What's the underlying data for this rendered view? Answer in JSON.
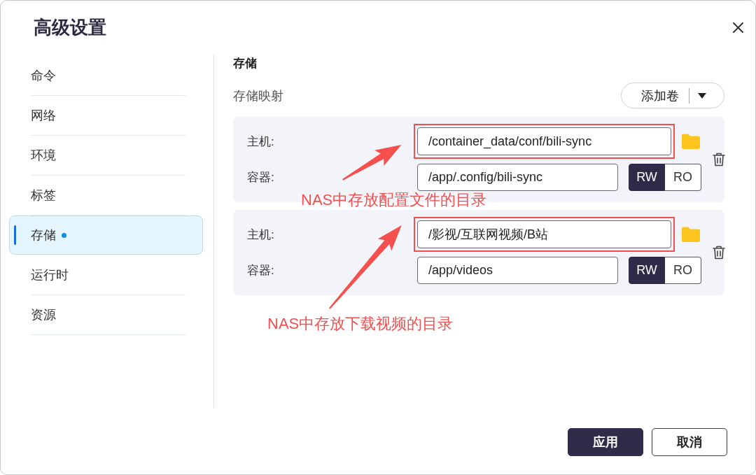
{
  "window": {
    "title": "高级设置"
  },
  "sidebar": {
    "items": [
      {
        "label": "命令",
        "selected": false,
        "modified": false
      },
      {
        "label": "网络",
        "selected": false,
        "modified": false
      },
      {
        "label": "环境",
        "selected": false,
        "modified": false
      },
      {
        "label": "标签",
        "selected": false,
        "modified": false
      },
      {
        "label": "存储",
        "selected": true,
        "modified": true
      },
      {
        "label": "运行时",
        "selected": false,
        "modified": false
      },
      {
        "label": "资源",
        "selected": false,
        "modified": false
      }
    ]
  },
  "storage": {
    "heading": "存储",
    "mapping_label": "存储映射",
    "add_button": "添加卷",
    "mounts": [
      {
        "host_label": "主机:",
        "host_path": "/container_data/conf/bili-sync",
        "host_highlighted": true,
        "container_label": "容器:",
        "container_path": "/app/.config/bili-sync",
        "modes": [
          {
            "label": "RW",
            "selected": true
          },
          {
            "label": "RO",
            "selected": false
          }
        ],
        "annotation": "NAS中存放配置文件的目录"
      },
      {
        "host_label": "主机:",
        "host_path": "/影视/互联网视频/B站",
        "host_highlighted": true,
        "container_label": "容器:",
        "container_path": "/app/videos",
        "modes": [
          {
            "label": "RW",
            "selected": true
          },
          {
            "label": "RO",
            "selected": false
          }
        ],
        "annotation": "NAS中存放下载视频的目录"
      }
    ]
  },
  "footer": {
    "buttons": [
      {
        "label": "应用",
        "kind": "primary"
      },
      {
        "label": "取消",
        "kind": "secondary"
      }
    ]
  }
}
